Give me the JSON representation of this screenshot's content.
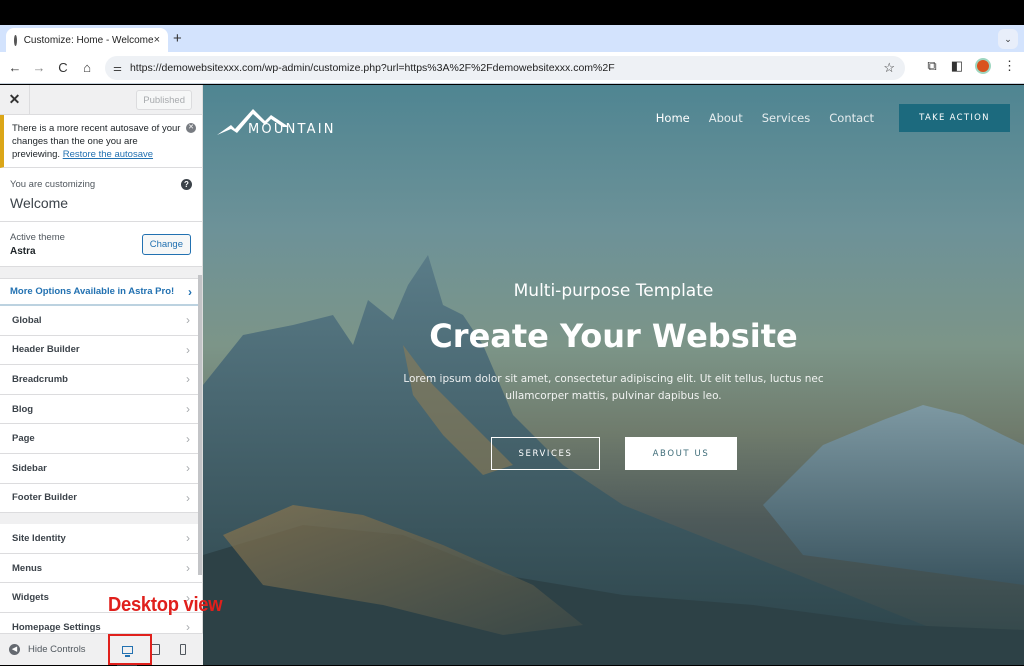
{
  "browser": {
    "tab_title": "Customize: Home - Welcome",
    "tab_close": "×",
    "new_tab": "+",
    "tab_menu": "⌄",
    "back": "←",
    "forward": "→",
    "reload": "C",
    "home": "⌂",
    "site_info": "⚌",
    "url": "https://demowebsitexxx.com/wp-admin/customize.php?url=https%3A%2F%2Fdemowebsitexxx.com%2F",
    "bookmark": "☆",
    "extensions": "⧉",
    "sidepanel": "◧",
    "menu": "⋮"
  },
  "customizer": {
    "close": "✕",
    "published_label": "Published",
    "notice": {
      "text": "There is a more recent autosave of your changes than the one you are previewing.",
      "link": "Restore the autosave",
      "dismiss": "✕"
    },
    "customizing_label": "You are customizing",
    "customizing_value": "Welcome",
    "help": "?",
    "active_theme_label": "Active theme",
    "active_theme_value": "Astra",
    "change_label": "Change",
    "pro_link": "More Options Available in Astra Pro!",
    "sections_group1": [
      "Global",
      "Header Builder",
      "Breadcrumb",
      "Blog",
      "Page",
      "Sidebar",
      "Footer Builder"
    ],
    "sections_group2": [
      "Site Identity",
      "Menus",
      "Widgets",
      "Homepage Settings"
    ],
    "chevron": "›",
    "hide_controls": "Hide Controls",
    "hide_icon": "◀",
    "devices": [
      "desktop",
      "tablet",
      "mobile"
    ],
    "active_device": "desktop"
  },
  "annotation": {
    "text": "Desktop view",
    "color": "#e0201c"
  },
  "site": {
    "logo": "MOUNTAIN",
    "nav": [
      "Home",
      "About",
      "Services",
      "Contact"
    ],
    "active_nav": "Home",
    "cta": "TAKE ACTION",
    "hero_subtitle": "Multi-purpose Template",
    "hero_title": "Create Your Website",
    "hero_body_line1": "Lorem ipsum dolor sit amet, consectetur adipiscing elit. Ut elit tellus, luctus nec",
    "hero_body_line2": "ullamcorper mattis, pulvinar dapibus leo.",
    "btn_services": "SERVICES",
    "btn_about": "ABOUT US",
    "accent": "#1c6a7e"
  }
}
